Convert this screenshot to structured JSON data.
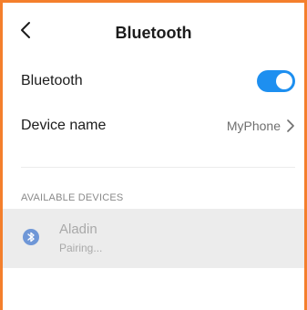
{
  "header": {
    "title": "Bluetooth",
    "back_icon": "chevron-left-icon"
  },
  "bluetooth_row": {
    "label": "Bluetooth",
    "toggle_on": true,
    "accent_color": "#1d8ff0"
  },
  "device_name_row": {
    "label": "Device name",
    "value": "MyPhone",
    "chevron_icon": "chevron-right-icon"
  },
  "available_devices": {
    "header": "AVAILABLE DEVICES",
    "items": [
      {
        "name": "Aladin",
        "status": "Pairing...",
        "icon": "bluetooth-icon",
        "icon_color": "#6f97d7"
      }
    ]
  },
  "frame_color": "#f47f2c"
}
